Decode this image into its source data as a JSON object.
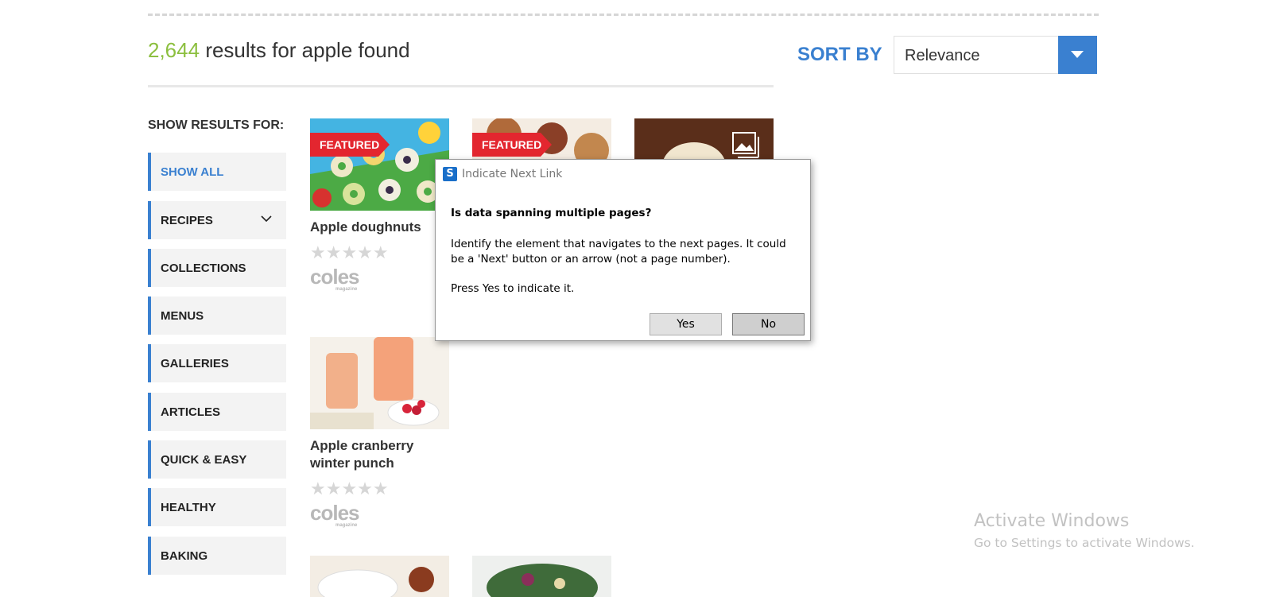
{
  "results": {
    "count": "2,644",
    "text": "results for apple found"
  },
  "sort": {
    "label": "SORT BY",
    "value": "Relevance",
    "accent": "#3a80d0"
  },
  "sidebar": {
    "heading": "SHOW RESULTS FOR:",
    "items": [
      {
        "label": "SHOW ALL",
        "active": true
      },
      {
        "label": "RECIPES",
        "has_dropdown": true
      },
      {
        "label": "COLLECTIONS"
      },
      {
        "label": "MENUS"
      },
      {
        "label": "GALLERIES"
      },
      {
        "label": "ARTICLES"
      },
      {
        "label": "QUICK & EASY"
      },
      {
        "label": "HEALTHY"
      },
      {
        "label": "BAKING"
      }
    ]
  },
  "cards": [
    {
      "title": "Apple doughnuts",
      "badge": "FEATURED",
      "brand": "coles",
      "brand_sub": "magazine",
      "rating": "★★★★★"
    },
    {
      "title": "",
      "badge": "FEATURED"
    },
    {
      "title": "",
      "icon": "gallery-icon"
    },
    {
      "title": "Apple cranberry winter punch",
      "brand": "coles",
      "brand_sub": "magazine",
      "rating": "★★★★★"
    }
  ],
  "dialog": {
    "title": "Indicate Next Link",
    "icon": "S",
    "question": "Is data spanning multiple pages?",
    "body": "Identify the element that navigates to the next pages. It could be a 'Next' button or an arrow (not a page number).",
    "instruction": "Press Yes to indicate it.",
    "yes_label": "Yes",
    "no_label": "No"
  },
  "watermark": {
    "title": "Activate Windows",
    "subtitle": "Go to Settings to activate Windows."
  }
}
